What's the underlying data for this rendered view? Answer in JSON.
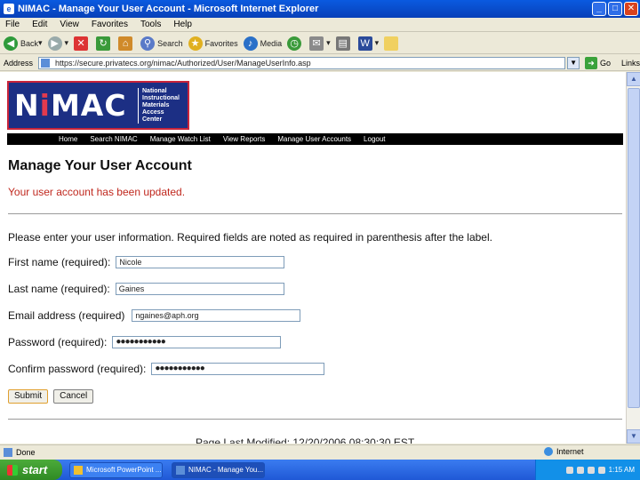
{
  "window": {
    "title": "NIMAC - Manage Your User Account - Microsoft Internet Explorer",
    "minimize": "_",
    "maximize": "□",
    "close": "✕"
  },
  "menu": [
    "File",
    "Edit",
    "View",
    "Favorites",
    "Tools",
    "Help"
  ],
  "toolbar": {
    "back": "Back",
    "search": "Search",
    "favorites": "Favorites",
    "media": "Media"
  },
  "address": {
    "label": "Address",
    "url": "https://secure.privatecs.org/nimac/Authorized/User/ManageUserInfo.asp",
    "go": "Go",
    "links": "Links"
  },
  "logo": {
    "text_pre": "N",
    "text_i": "i",
    "text_post": "MAC",
    "line1": "National",
    "line2": "Instructional",
    "line3": "Materials",
    "line4": "Access",
    "line5": "Center"
  },
  "nav": [
    "Home",
    "Search NIMAC",
    "Manage Watch List",
    "View Reports",
    "Manage User Accounts",
    "Logout"
  ],
  "page": {
    "heading": "Manage Your User Account",
    "message": "Your user account has been updated.",
    "instructions": "Please enter your user information. Required fields are noted as required in parenthesis after the label.",
    "first_name_label": "First name (required):",
    "first_name_value": "Nicole",
    "last_name_label": "Last name (required):",
    "last_name_value": "Gaines",
    "email_label": "Email address (required)",
    "email_value": "ngaines@aph.org",
    "password_label": "Password (required):",
    "password_value": "●●●●●●●●●●●",
    "confirm_label": "Confirm password (required):",
    "confirm_value": "●●●●●●●●●●●",
    "submit": "Submit",
    "cancel": "Cancel",
    "modified": "Page Last Modified: 12/20/2006 08:30:30 EST"
  },
  "status": {
    "done": "Done",
    "zone": "Internet"
  },
  "taskbar": {
    "start": "start",
    "task1": "Microsoft PowerPoint ...",
    "task2": "NIMAC - Manage You...",
    "clock": "1:15 AM"
  }
}
